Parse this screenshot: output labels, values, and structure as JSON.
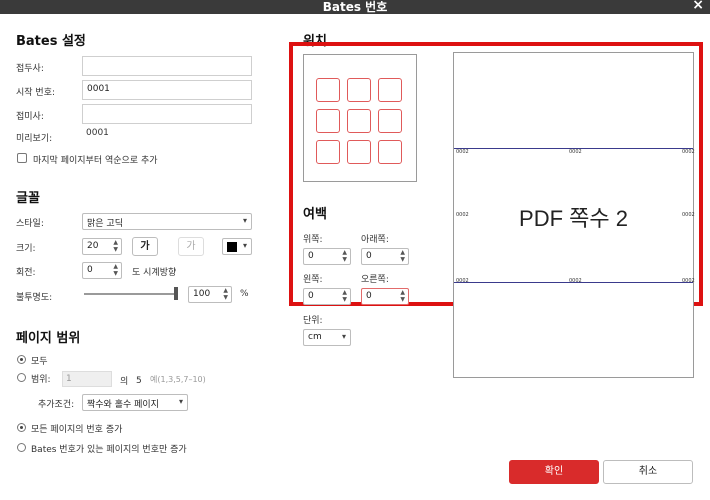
{
  "window": {
    "title": "Bates 번호",
    "close_glyph": "×"
  },
  "bates": {
    "heading": "Bates 설정",
    "prefix_label": "접두사:",
    "prefix_value": "",
    "start_label": "시작 번호:",
    "start_value": "0001",
    "suffix_label": "접미사:",
    "suffix_value": "",
    "preview_label": "미리보기:",
    "preview_value": "0001",
    "reverse_label": "마지막 페이지부터 역순으로 추가"
  },
  "font": {
    "heading": "글꼴",
    "style_label": "스타일:",
    "style_value": "맑은 고딕",
    "size_label": "크기:",
    "size_value": "20",
    "bold_label": "가",
    "italic_label": "가",
    "rotate_label": "회전:",
    "rotate_value": "0",
    "clockwise_label": "도 시계방향",
    "opacity_label": "불투명도:",
    "opacity_value": "100",
    "opacity_percent": 100,
    "percent_sign": "%"
  },
  "range": {
    "heading": "페이지 범위",
    "all_label": "모두",
    "range_label": "범위:",
    "range_value": "1",
    "of_label": "의",
    "total": "5",
    "example": "예(1,3,5,7–10)",
    "condition_label": "추가조건:",
    "condition_value": "짝수와 홀수 페이지",
    "apply_all_label": "모든 페이지의 번호 증가",
    "apply_bates_label": "Bates 번호가 있는 페이지의 번호만 증가"
  },
  "position": {
    "heading": "위치"
  },
  "margin": {
    "heading": "여백",
    "top_label": "위쪽:",
    "top_value": "0",
    "bottom_label": "아래쪽:",
    "bottom_value": "0",
    "left_label": "왼쪽:",
    "left_value": "0",
    "right_label": "오른쪽:",
    "right_value": "0",
    "unit_label": "단위:",
    "unit_value": "cm"
  },
  "preview": {
    "page_text": "PDF 쪽수 2",
    "stamp": "0002"
  },
  "buttons": {
    "ok": "확인",
    "cancel": "취소"
  },
  "colors": {
    "accent_red": "#dd1111",
    "ok_button": "#d92b2b",
    "grid_cell_border": "#e05a5a",
    "preview_band": "#3a3a8c"
  }
}
